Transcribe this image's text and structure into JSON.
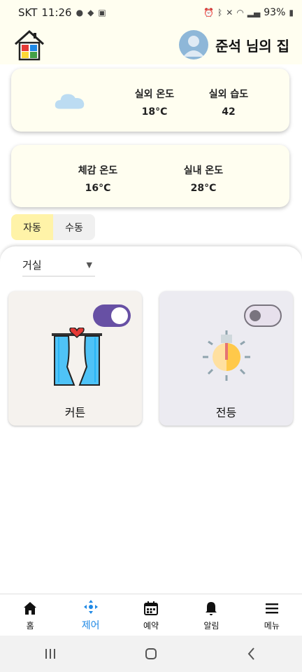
{
  "status_bar": {
    "carrier": "SKT",
    "time": "11:26",
    "battery": "93%"
  },
  "header": {
    "home_title": "준석 님의 집"
  },
  "weather": {
    "outdoor_temp_label": "실외 온도",
    "outdoor_temp_value": "18°C",
    "outdoor_humidity_label": "실외 습도",
    "outdoor_humidity_value": "42"
  },
  "indoor": {
    "feels_like_label": "체감 온도",
    "feels_like_value": "16°C",
    "indoor_temp_label": "실내 온도",
    "indoor_temp_value": "28°C"
  },
  "mode": {
    "auto_label": "자동",
    "manual_label": "수동",
    "selected": "자동"
  },
  "room": {
    "selected": "거실"
  },
  "devices": [
    {
      "name": "커튼",
      "on": true
    },
    {
      "name": "전등",
      "on": false
    }
  ],
  "bottom_nav": {
    "items": [
      {
        "label": "홈",
        "icon": "home-icon"
      },
      {
        "label": "제어",
        "icon": "control-icon",
        "active": true
      },
      {
        "label": "예약",
        "icon": "calendar-icon"
      },
      {
        "label": "알림",
        "icon": "bell-icon"
      },
      {
        "label": "메뉴",
        "icon": "menu-icon"
      }
    ]
  },
  "colors": {
    "accent": "#fffef0",
    "selected_mode": "#fff3a8",
    "switch_on": "#6750a4",
    "nav_active": "#1e88e5"
  }
}
